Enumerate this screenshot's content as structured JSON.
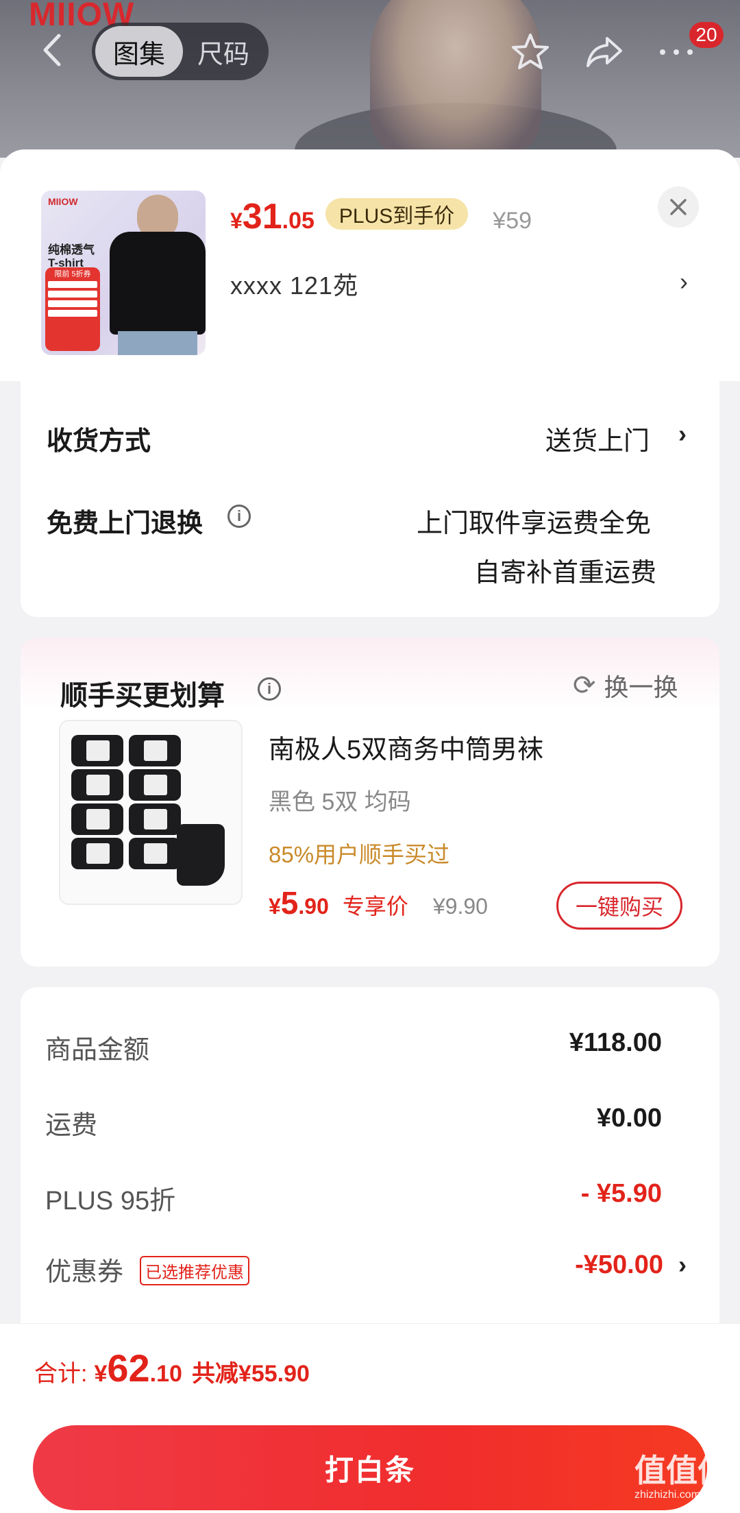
{
  "header": {
    "brand_logo": "MIIOW",
    "tabs": [
      {
        "label": "图集",
        "active": true
      },
      {
        "label": "尺码",
        "active": false
      }
    ],
    "cart_badge": "20",
    "icons": [
      "back-arrow-icon",
      "star-icon",
      "share-icon",
      "more-icon"
    ]
  },
  "product": {
    "price_yen": "¥",
    "price_int": "31",
    "price_dec": ".05",
    "plus_tag": "PLUS到手价",
    "original_price": "¥59",
    "spec": "xxxx  121苑",
    "thumb": {
      "logo": "MIIOW",
      "line1": "纯棉透气",
      "line2": "T-shirt",
      "promo": "限前 5折券"
    }
  },
  "delivery": {
    "method_label": "收货方式",
    "method_value": "送货上门",
    "return_label": "免费上门退换",
    "return_line1": "上门取件享运费全免",
    "return_line2": "自寄补首重运费"
  },
  "addon": {
    "title": "顺手买更划算",
    "swap_label": "换一换",
    "name": "南极人5双商务中筒男袜",
    "spec": "黑色 5双   均码",
    "social_proof": "85%用户顺手买过",
    "price_yen": "¥",
    "price_int": "5",
    "price_dec": ".90",
    "price_label": "专享价",
    "original_price": "¥9.90",
    "buy_button": "一键购买"
  },
  "summary": {
    "rows": [
      {
        "label": "商品金额",
        "value": "¥118.00"
      },
      {
        "label": "运费",
        "value": "¥0.00"
      },
      {
        "label": "PLUS 95折",
        "value": "- ¥5.90"
      },
      {
        "label": "优惠券",
        "value": "-¥50.00",
        "tag": "已选推荐优惠"
      }
    ]
  },
  "footer": {
    "total_label": "合计:",
    "total_yen": "¥",
    "total_int": "62",
    "total_dec": ".10",
    "saved_text": "共减¥55.90",
    "pay_button": "打白条"
  },
  "watermark": {
    "text": "值值值",
    "url": "zhizhizhi.com"
  },
  "colors": {
    "accent_red": "#e2231a",
    "plus_gold": "#f6e3a8",
    "social_orange": "#c98a2a"
  }
}
